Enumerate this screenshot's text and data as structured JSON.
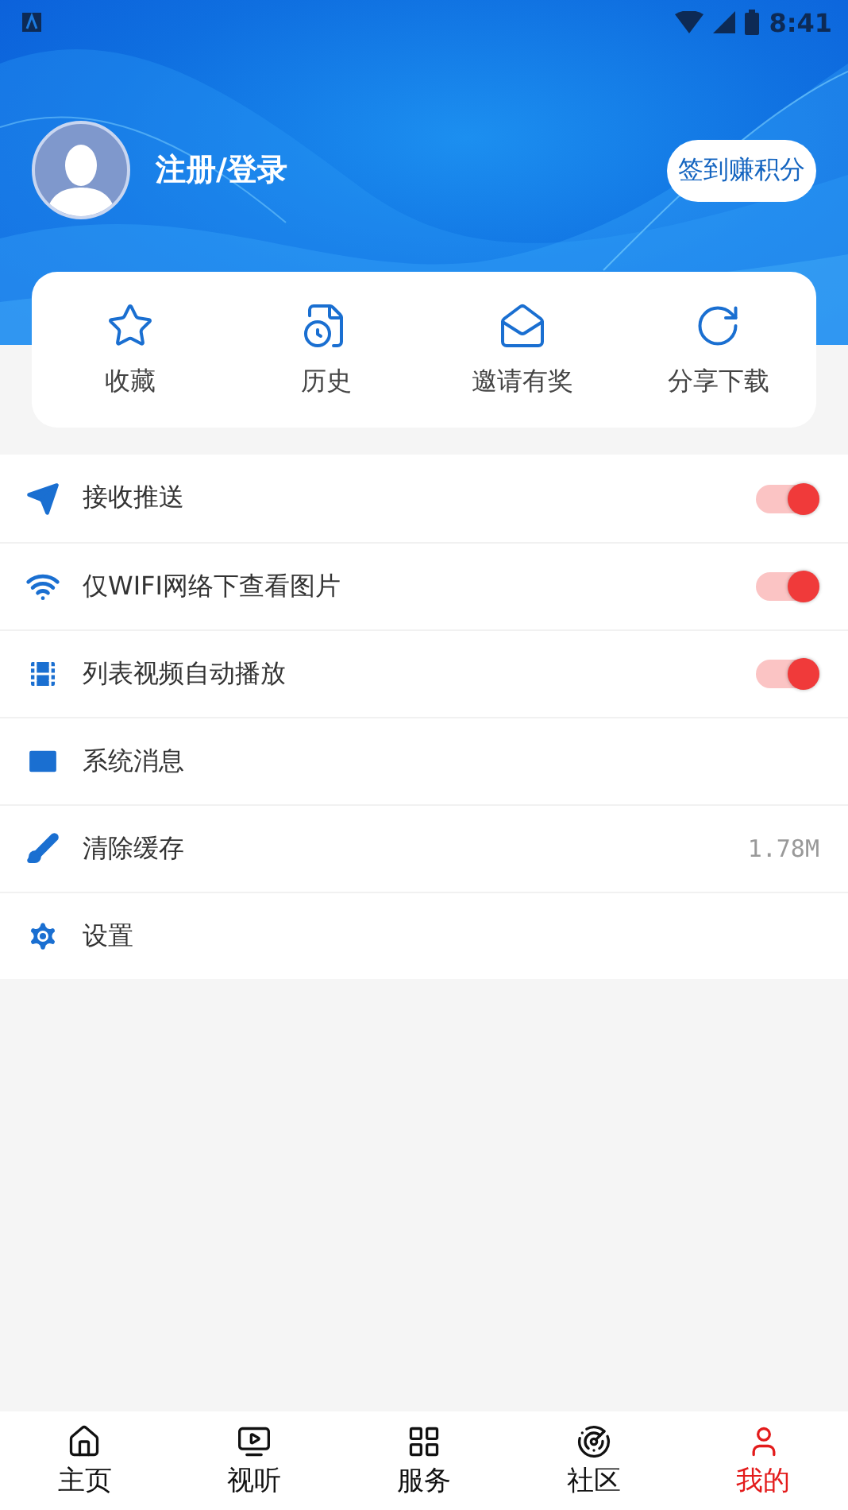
{
  "status_bar": {
    "time": "8:41"
  },
  "profile": {
    "name": "注册/登录",
    "checkin_button": "签到赚积分"
  },
  "quick_actions": [
    {
      "kind": "star",
      "label": "收藏"
    },
    {
      "kind": "history",
      "label": "历史"
    },
    {
      "kind": "invite",
      "label": "邀请有奖"
    },
    {
      "kind": "share",
      "label": "分享下载"
    }
  ],
  "settings": [
    {
      "kind": "toggle",
      "label": "接收推送",
      "on": true
    },
    {
      "kind": "toggle",
      "label": "仅WIFI网络下查看图片",
      "on": true
    },
    {
      "kind": "toggle",
      "label": "列表视频自动播放",
      "on": true
    },
    {
      "kind": "link",
      "label": "系统消息"
    },
    {
      "kind": "value",
      "label": "清除缓存",
      "value": "1.78M"
    },
    {
      "kind": "link",
      "label": "设置"
    }
  ],
  "bottom_nav": [
    {
      "label": "主页",
      "selected": false
    },
    {
      "label": "视听",
      "selected": false
    },
    {
      "label": "服务",
      "selected": false
    },
    {
      "label": "社区",
      "selected": false
    },
    {
      "label": "我的",
      "selected": true
    }
  ]
}
